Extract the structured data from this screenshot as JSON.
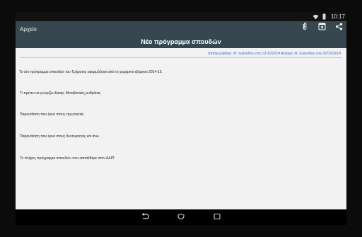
{
  "status": {
    "time": "10:17"
  },
  "appbar": {
    "left_title": "Αρχείο",
    "center_title": "Νέο πρόγραμμα σπουδών"
  },
  "content": {
    "meta": "Καταχωρήθηκε: Μ. Ιωαννίδου στις 01/10/2014 Αλλαγή: Μ. Ιωαννίδου στις 02/10/2014",
    "intro": "Το νέο πρόγραμμα σπουδών του Τμήματος εφαρμόζεται από το χειμερινό εξάμηνο 2014-15.",
    "items": [
      "Τι πρέπει να γνωρίζω &amp; Μεταβατικές ρυθμίσεις",
      "Παρουσίαση που έγινε στους πρωτοετείς",
      "Παρουσίαση που έγινε στους δευτεροετείς και άνω",
      "Το πλήρες πρόγραμμα σπουδών που κατατέθηκε στον ΑΔΙΠ"
    ]
  },
  "icons": {
    "attach": "paperclip-icon",
    "open": "open-in-app-icon",
    "share": "share-icon",
    "back": "back-icon",
    "home": "home-icon",
    "recents": "recents-icon",
    "wifi": "wifi-icon",
    "battery": "battery-icon"
  },
  "colors": {
    "appbar": "#37474f",
    "content_bg": "#f2f2f2",
    "meta_text": "#3b6fc4"
  }
}
